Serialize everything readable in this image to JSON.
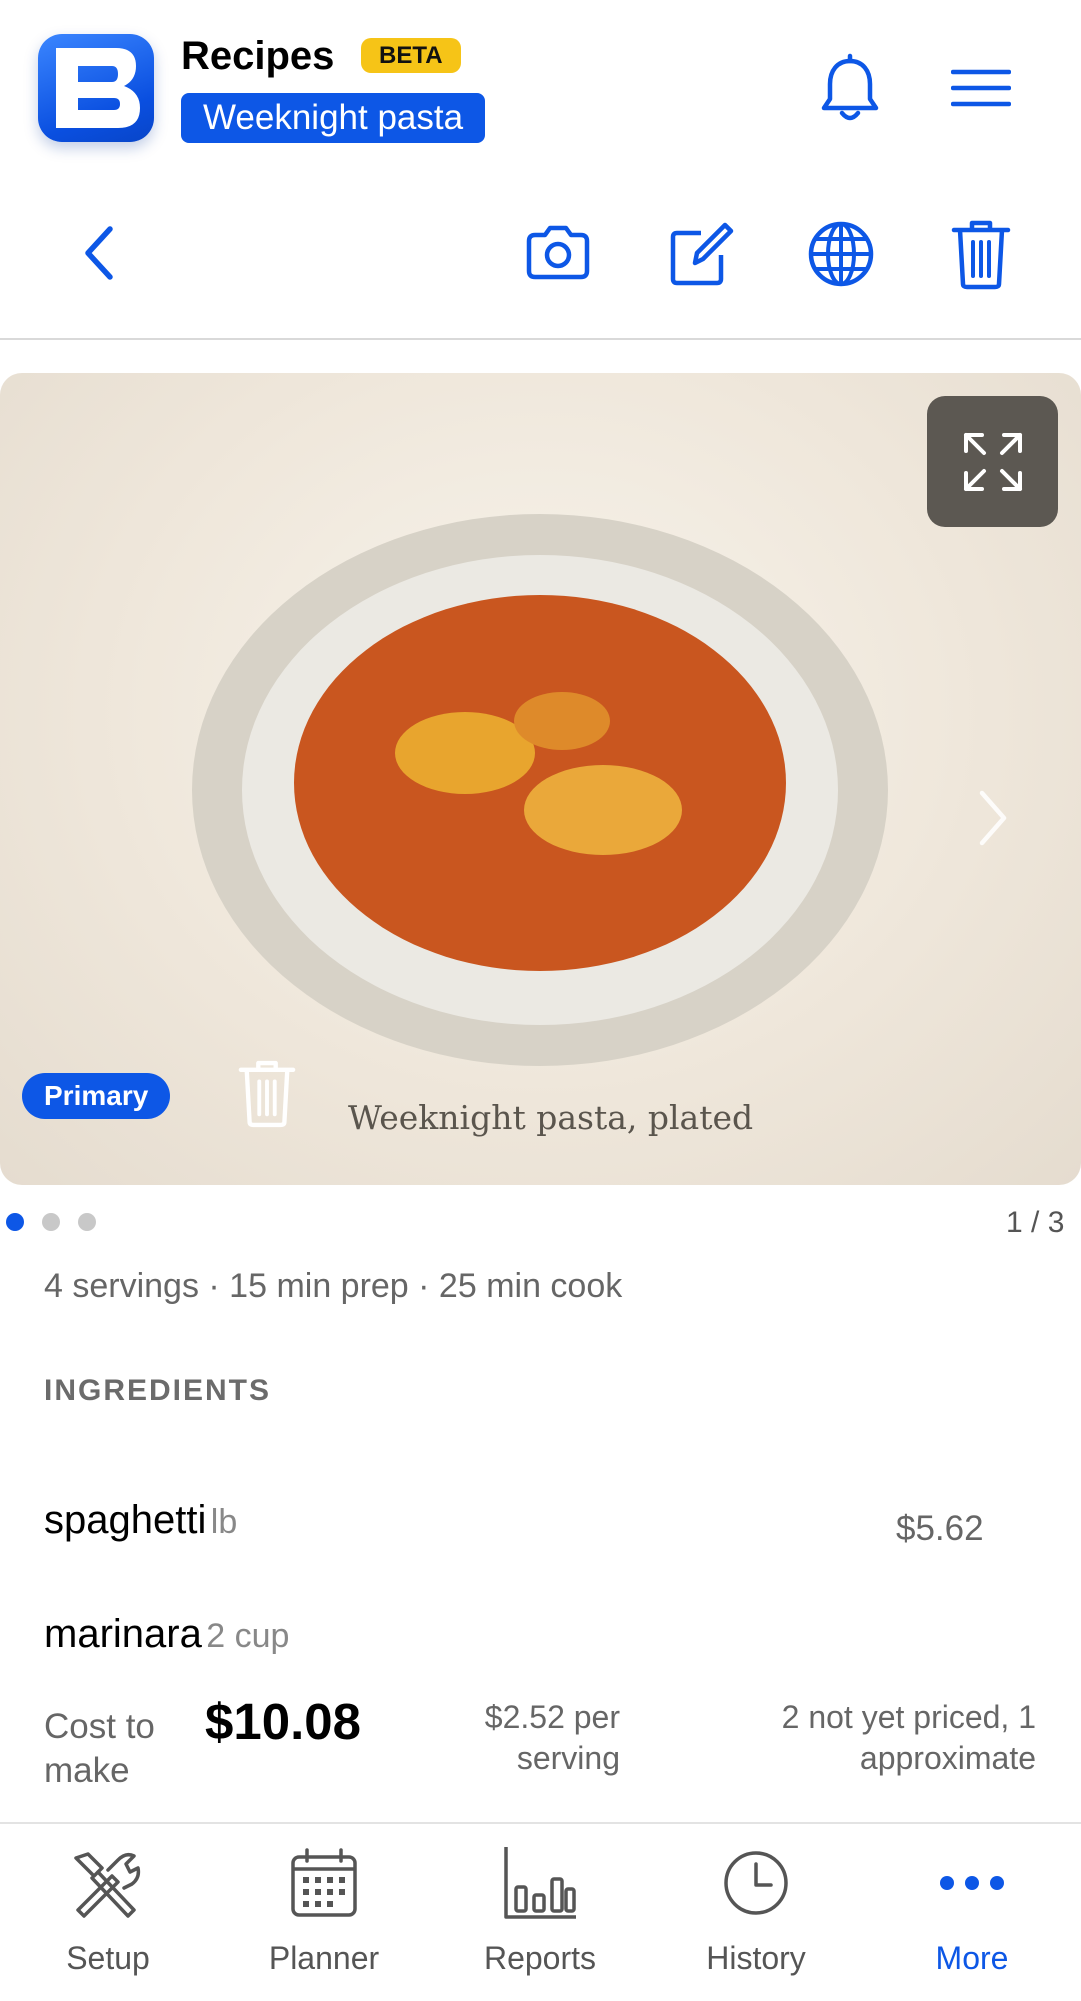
{
  "header": {
    "app_title": "Recipes",
    "beta_badge": "BETA",
    "recipe_name": "Weeknight pasta"
  },
  "toolbar": {
    "icons": [
      "back-chevron-icon",
      "camera-icon",
      "edit-icon",
      "globe-icon",
      "trash-icon"
    ]
  },
  "gallery": {
    "badge": "Primary",
    "caption": "Weeknight pasta, plated",
    "counter": "1 / 3",
    "active_index": 1,
    "total": 3
  },
  "recipe": {
    "meta": "4 servings · 15 min prep · 25 min cook",
    "ingredients_heading": "INGREDIENTS",
    "ingredients": [
      {
        "name": "spaghetti",
        "unit": "lb",
        "price": "$5.62"
      },
      {
        "name": "marinara",
        "unit": "2 cup",
        "price": ""
      }
    ]
  },
  "cost": {
    "label": "Cost to make",
    "total": "$10.08",
    "per_serving": "$2.52 per serving",
    "note": "2 not yet priced, 1 approximate"
  },
  "tabs": [
    {
      "label": "Setup",
      "icon": "tools-icon"
    },
    {
      "label": "Planner",
      "icon": "calendar-icon"
    },
    {
      "label": "Reports",
      "icon": "bar-chart-icon"
    },
    {
      "label": "History",
      "icon": "clock-icon"
    },
    {
      "label": "More",
      "icon": "more-dots-icon",
      "active": true
    }
  ],
  "colors": {
    "accent": "#0d57e6",
    "beta": "#f6c417",
    "sauce": "#c9561f"
  }
}
